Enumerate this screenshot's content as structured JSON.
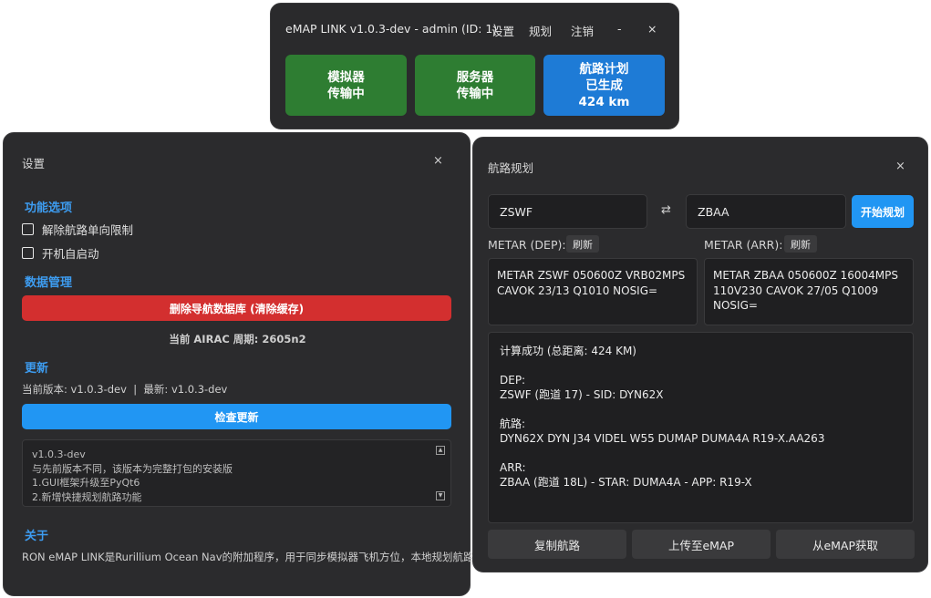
{
  "topbar": {
    "title": "eMAP LINK v1.0.3-dev - admin (ID: 1)",
    "menu": {
      "settings": "设置",
      "planning": "规划",
      "logout": "注销",
      "minimize": "-",
      "close": "×"
    },
    "status": {
      "simulator": {
        "line1": "模拟器",
        "line2": "传输中"
      },
      "server": {
        "line1": "服务器",
        "line2": "传输中"
      },
      "route": {
        "line1": "航路计划",
        "line2": "已生成",
        "line3": "424 km"
      }
    }
  },
  "settings": {
    "title": "设置",
    "close": "×",
    "features": {
      "heading": "功能选项",
      "option1": "解除航路单向限制",
      "option2": "开机自启动"
    },
    "data": {
      "heading": "数据管理",
      "delete_button": "删除导航数据库 (清除缓存)",
      "airac": "当前 AIRAC 周期: 2605n2"
    },
    "update": {
      "heading": "更新",
      "version_info": "当前版本: v1.0.3-dev  |  最新: v1.0.3-dev",
      "check_button": "检查更新",
      "changelog": [
        "v1.0.3-dev",
        "与先前版本不同，该版本为完整打包的安装版",
        "1.GUI框架升级至PyQt6",
        "2.新增快捷规划航路功能"
      ]
    },
    "about": {
      "heading": "关于",
      "text": "RON eMAP LINK是Rurillium Ocean Nav的附加程序，用于同步模拟器飞机方位，本地规划航路"
    }
  },
  "route": {
    "title": "航路规划",
    "close": "×",
    "dep": "ZSWF",
    "arr": "ZBAA",
    "swap_icon": "⇄",
    "plan_button": "开始规划",
    "metar_dep_label": "METAR (DEP):",
    "metar_arr_label": "METAR (ARR):",
    "refresh": "刷新",
    "metar_dep": "METAR ZSWF 050600Z VRB02MPS CAVOK 23/13 Q1010 NOSIG=",
    "metar_arr": "METAR ZBAA 050600Z 16004MPS 110V230 CAVOK 27/05 Q1009 NOSIG=",
    "result": {
      "summary": "计算成功 (总距离: 424 KM)",
      "dep_label": "DEP:",
      "dep_detail": "ZSWF (跑道 17) - SID: DYN62X",
      "route_label": "航路:",
      "route_detail": "DYN62X DYN J34 VIDEL W55 DUMAP DUMA4A R19-X.AA263",
      "arr_label": "ARR:",
      "arr_detail": "ZBAA (跑道 18L) - STAR: DUMA4A - APP: R19-X"
    },
    "buttons": {
      "copy": "复制航路",
      "upload": "上传至eMAP",
      "fetch": "从eMAP获取"
    }
  }
}
